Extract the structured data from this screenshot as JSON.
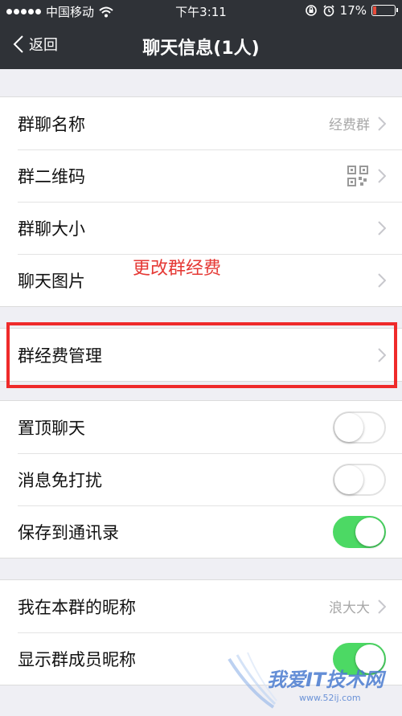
{
  "status_bar": {
    "carrier": "中国移动",
    "time": "下午3:11",
    "battery_text": "17%",
    "battery_level": 0.17
  },
  "nav": {
    "back_label": "返回",
    "title": "聊天信息(1人)"
  },
  "group1": [
    {
      "label": "群聊名称",
      "value": "经费群"
    },
    {
      "label": "群二维码",
      "value": ""
    },
    {
      "label": "群聊大小",
      "value": ""
    },
    {
      "label": "聊天图片",
      "value": ""
    }
  ],
  "group2": [
    {
      "label": "群经费管理"
    }
  ],
  "group3": [
    {
      "label": "置顶聊天",
      "on": false
    },
    {
      "label": "消息免打扰",
      "on": false
    },
    {
      "label": "保存到通讯录",
      "on": true
    }
  ],
  "group4": [
    {
      "label": "我在本群的昵称",
      "value": "浪大大"
    },
    {
      "label": "显示群成员昵称",
      "on": true
    }
  ],
  "annotation": {
    "text": "更改群经费",
    "color": "#e53935"
  },
  "watermark": {
    "text": "我爱IT技术网",
    "sub": "www.52ij.com"
  },
  "colors": {
    "nav_bg": "#2f3237",
    "toggle_on": "#4cd964",
    "highlight_box": "#ef2a2a"
  }
}
